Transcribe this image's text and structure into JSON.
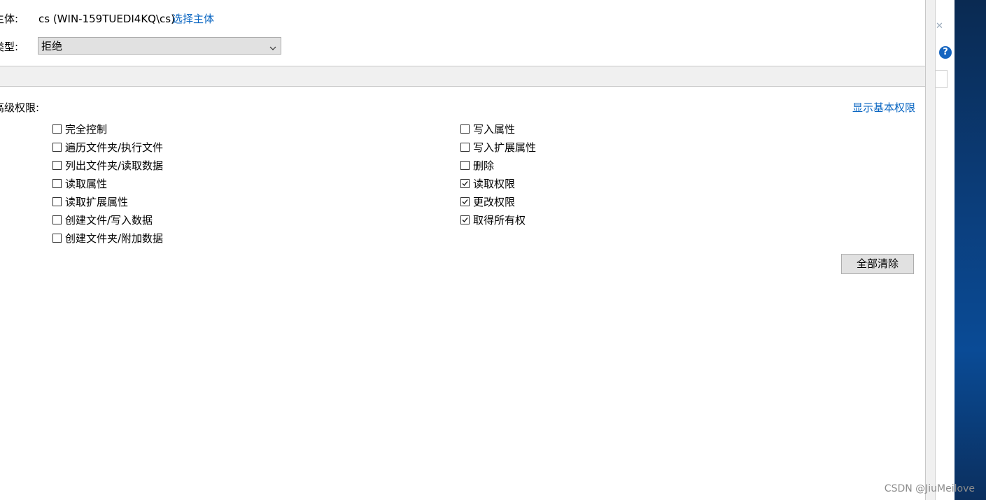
{
  "principal": {
    "label": "主体:",
    "value": "cs (WIN-159TUEDI4KQ\\cs)",
    "select_link": "选择主体"
  },
  "type": {
    "label": "类型:",
    "value": "拒绝"
  },
  "permissions": {
    "heading": "高级权限:",
    "show_basic_link": "显示基本权限",
    "left": [
      {
        "label": "完全控制",
        "checked": false
      },
      {
        "label": "遍历文件夹/执行文件",
        "checked": false
      },
      {
        "label": "列出文件夹/读取数据",
        "checked": false
      },
      {
        "label": "读取属性",
        "checked": false
      },
      {
        "label": "读取扩展属性",
        "checked": false
      },
      {
        "label": "创建文件/写入数据",
        "checked": false
      },
      {
        "label": "创建文件夹/附加数据",
        "checked": false
      }
    ],
    "right": [
      {
        "label": "写入属性",
        "checked": false
      },
      {
        "label": "写入扩展属性",
        "checked": false
      },
      {
        "label": "删除",
        "checked": false
      },
      {
        "label": "读取权限",
        "checked": true
      },
      {
        "label": "更改权限",
        "checked": true
      },
      {
        "label": "取得所有权",
        "checked": true
      }
    ],
    "clear_all_button": "全部清除"
  },
  "side": {
    "help_icon": "?"
  },
  "watermark": "CSDN @JiuMeilove",
  "colors": {
    "link": "#0a66c2",
    "desktop": "#0b3d7a"
  }
}
